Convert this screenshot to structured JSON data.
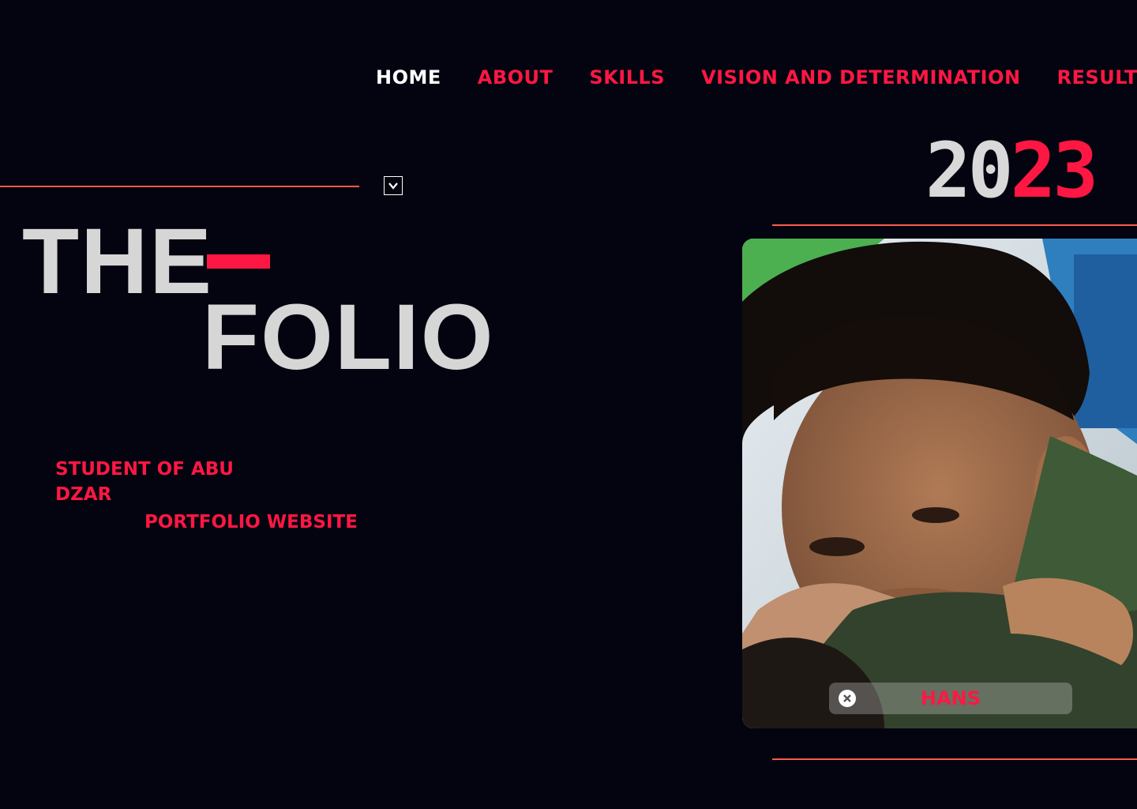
{
  "nav": {
    "items": [
      {
        "label": "HOME",
        "active": true
      },
      {
        "label": "ABOUT",
        "active": false
      },
      {
        "label": "SKILLS",
        "active": false
      },
      {
        "label": "VISION AND DETERMINATION",
        "active": false
      },
      {
        "label": "RESULTS",
        "active": false
      }
    ]
  },
  "year": {
    "first": "20",
    "second": "23"
  },
  "hero": {
    "line1": "THE",
    "line2": "FOLIO"
  },
  "subtitle": "STUDENT OF ABU DZAR",
  "tagline": "PORTFOLIO WEBSITE",
  "profile": {
    "name": "HANS",
    "close_icon": "close-circle-icon"
  },
  "icons": {
    "scroll": "chevron-down-icon"
  },
  "colors": {
    "background": "#03040f",
    "accent": "#ff1744",
    "rule": "#ff5a4f",
    "text_light": "#d6d6d6"
  }
}
